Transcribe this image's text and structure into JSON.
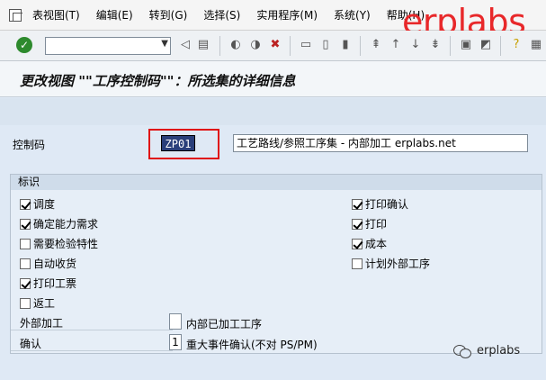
{
  "menu": {
    "items": [
      "表视图(T)",
      "编辑(E)",
      "转到(G)",
      "选择(S)",
      "实用程序(M)",
      "系统(Y)",
      "帮助(H)"
    ]
  },
  "brand": "erplabs",
  "toolbar": {
    "command_value": "",
    "icons": [
      "enter-icon",
      "back-icon",
      "save-icon",
      "back-nav-icon",
      "exit-icon",
      "cancel-icon",
      "print-icon",
      "find-icon",
      "find-next-icon",
      "first-page-icon",
      "prev-page-icon",
      "next-page-icon",
      "last-page-icon",
      "create-session-icon",
      "shortcut-icon",
      "help-icon",
      "layout-icon"
    ]
  },
  "title": "更改视图 \"\"工序控制码\"\"：所选集的详细信息",
  "control": {
    "label": "控制码",
    "value": "ZP01",
    "description": "工艺路线/参照工序集 - 内部加工 erplabs.net"
  },
  "group": {
    "title": "标识",
    "left_items": [
      {
        "label": "调度",
        "checked": true
      },
      {
        "label": "确定能力需求",
        "checked": true
      },
      {
        "label": "需要检验特性",
        "checked": false
      },
      {
        "label": "自动收货",
        "checked": false
      },
      {
        "label": "打印工票",
        "checked": true
      },
      {
        "label": "返工",
        "checked": false
      }
    ],
    "right_items": [
      {
        "label": "打印确认",
        "checked": true
      },
      {
        "label": "打印",
        "checked": true
      },
      {
        "label": "成本",
        "checked": true
      },
      {
        "label": "计划外部工序",
        "checked": false
      }
    ],
    "external": {
      "label": "外部加工",
      "value": "",
      "text": "内部已加工工序"
    },
    "confirm": {
      "label": "确认",
      "value": "1",
      "text": "重大事件确认(不对 PS/PM)"
    }
  },
  "watermark": "erplabs"
}
